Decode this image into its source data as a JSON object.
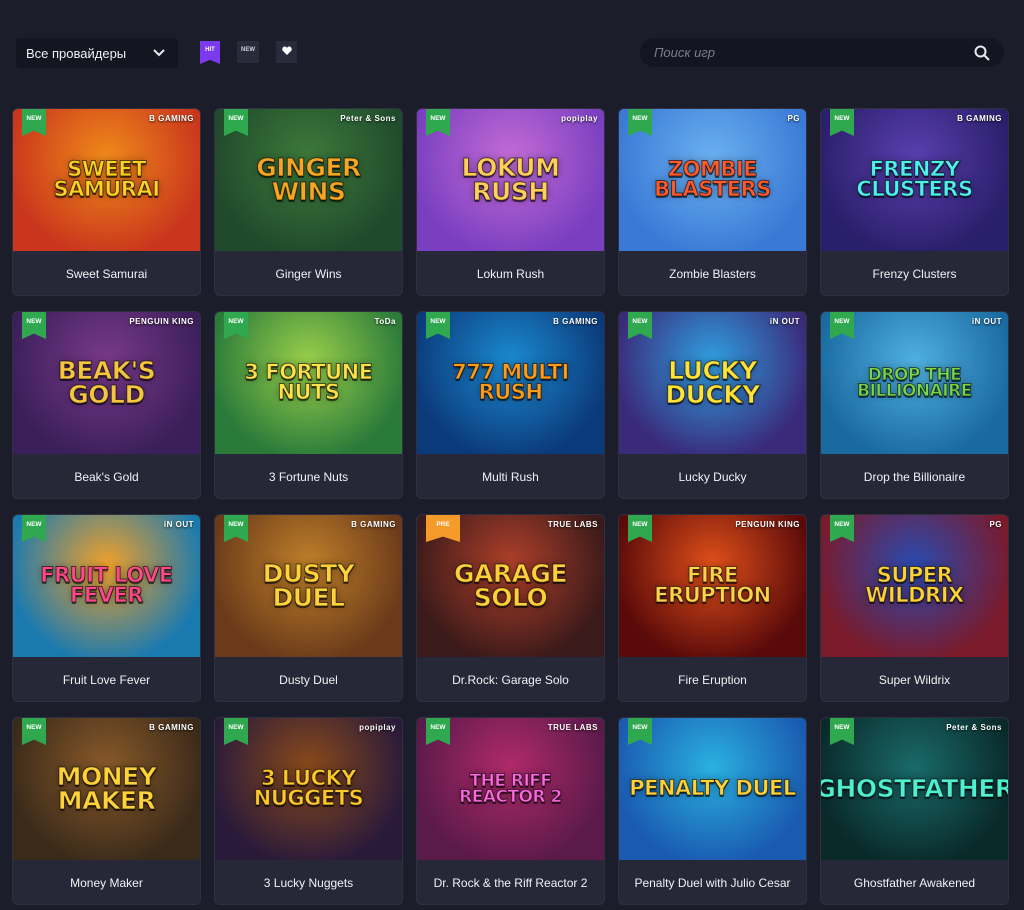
{
  "header": {
    "provider_select": "Все провайдеры",
    "filters": {
      "hit": "HIT",
      "new": "NEW"
    },
    "search_placeholder": "Поиск игр"
  },
  "games": [
    {
      "name": "Sweet Samurai",
      "art": "SWEET SAMURAI",
      "badge": "NEW",
      "provider": "B GAMING",
      "bg": [
        "#c9361d",
        "#f08a1a"
      ],
      "text": "#ffd21f"
    },
    {
      "name": "Ginger Wins",
      "art": "GINGER WINS",
      "badge": "NEW",
      "provider": "Peter & Sons",
      "bg": [
        "#1f4a2c",
        "#3e7a3a"
      ],
      "text": "#f5a623"
    },
    {
      "name": "Lokum Rush",
      "art": "Lokum Rush",
      "badge": "NEW",
      "provider": "popiplay",
      "bg": [
        "#7a3fc0",
        "#c46cd6"
      ],
      "text": "#ffcf5a"
    },
    {
      "name": "Zombie Blasters",
      "art": "ZOMBIE BLASTERS",
      "badge": "NEW",
      "provider": "PG",
      "bg": [
        "#3a7ad6",
        "#6bb0f0"
      ],
      "text": "#ff5a2a"
    },
    {
      "name": "Frenzy Clusters",
      "art": "FRENZY CLUSTERS",
      "badge": "NEW",
      "provider": "B GAMING",
      "bg": [
        "#2a1f6a",
        "#5a3fb0"
      ],
      "text": "#4ff0f0"
    },
    {
      "name": "Beak's Gold",
      "art": "Beak's GOLD",
      "badge": "NEW",
      "provider": "PENGUIN KING",
      "bg": [
        "#3b1f5a",
        "#7a3a8a"
      ],
      "text": "#f5c542"
    },
    {
      "name": "3 Fortune Nuts",
      "art": "3 FORTUNE NUTS",
      "badge": "NEW",
      "provider": "ToDa",
      "bg": [
        "#2a7a3a",
        "#9ad04a"
      ],
      "text": "#ffe14a"
    },
    {
      "name": "Multi Rush",
      "art": "777 MULTI RUSH",
      "badge": "NEW",
      "provider": "B GAMING",
      "bg": [
        "#0b3a7a",
        "#1b8ad0"
      ],
      "text": "#ff9a1a"
    },
    {
      "name": "Lucky Ducky",
      "art": "LUCKY DUCKY",
      "badge": "NEW",
      "provider": "iN OUT",
      "bg": [
        "#3a2a7a",
        "#2fa0e0"
      ],
      "text": "#ffe23a"
    },
    {
      "name": "Drop the Billionaire",
      "art": "DROP THE BILLIONAIRE",
      "badge": "NEW",
      "provider": "iN OUT",
      "bg": [
        "#1a6aa0",
        "#4fb0e0"
      ],
      "text": "#7ad64a"
    },
    {
      "name": "Fruit Love Fever",
      "art": "FRUIT LOVE FEVER",
      "badge": "NEW",
      "provider": "iN OUT",
      "bg": [
        "#1a7ab0",
        "#f0a02a"
      ],
      "text": "#ff4a8a"
    },
    {
      "name": "Dusty Duel",
      "art": "DUSTY DUEL",
      "badge": "NEW",
      "provider": "B GAMING",
      "bg": [
        "#6a3a1a",
        "#c0802a"
      ],
      "text": "#ffd23a"
    },
    {
      "name": "Dr.Rock: Garage Solo",
      "art": "GARAGE SOLO",
      "badge": "PRE",
      "provider": "TRUE LABS",
      "bg": [
        "#3a1a1a",
        "#b0402a"
      ],
      "text": "#ffcf3a"
    },
    {
      "name": "Fire Eruption",
      "art": "FIRE ERUPTION",
      "badge": "NEW",
      "provider": "PENGUIN KING",
      "bg": [
        "#5a0a0a",
        "#e0501a"
      ],
      "text": "#ffd24a"
    },
    {
      "name": "Super Wildrix",
      "art": "SUPER WILDRIX",
      "badge": "NEW",
      "provider": "PG",
      "bg": [
        "#7a1a2a",
        "#2a4ab0"
      ],
      "text": "#ffd23a"
    },
    {
      "name": "Money Maker",
      "art": "MONEY MAKER",
      "badge": "NEW",
      "provider": "B GAMING",
      "bg": [
        "#3a2a1a",
        "#8a5a2a"
      ],
      "text": "#ffd23a"
    },
    {
      "name": "3 Lucky Nuggets",
      "art": "3 LUCKY NUGGETS",
      "badge": "NEW",
      "provider": "popiplay",
      "bg": [
        "#2a1a3a",
        "#8a4a1a"
      ],
      "text": "#ffc82a"
    },
    {
      "name": "Dr. Rock & the Riff Reactor 2",
      "art": "THE RIFF REACTOR 2",
      "badge": "NEW",
      "provider": "TRUE LABS",
      "bg": [
        "#5a1a4a",
        "#b02a6a"
      ],
      "text": "#ff6ae0"
    },
    {
      "name": "Penalty Duel with Julio Cesar",
      "art": "PENALTY DUEL",
      "badge": "NEW",
      "provider": "",
      "bg": [
        "#1a5ab0",
        "#2ab0e0"
      ],
      "text": "#ffd23a"
    },
    {
      "name": "Ghostfather Awakened",
      "art": "GHOSTFATHER",
      "badge": "NEW",
      "provider": "Peter & Sons",
      "bg": [
        "#0a2a2a",
        "#1a6a6a"
      ],
      "text": "#4ff0d0"
    }
  ]
}
